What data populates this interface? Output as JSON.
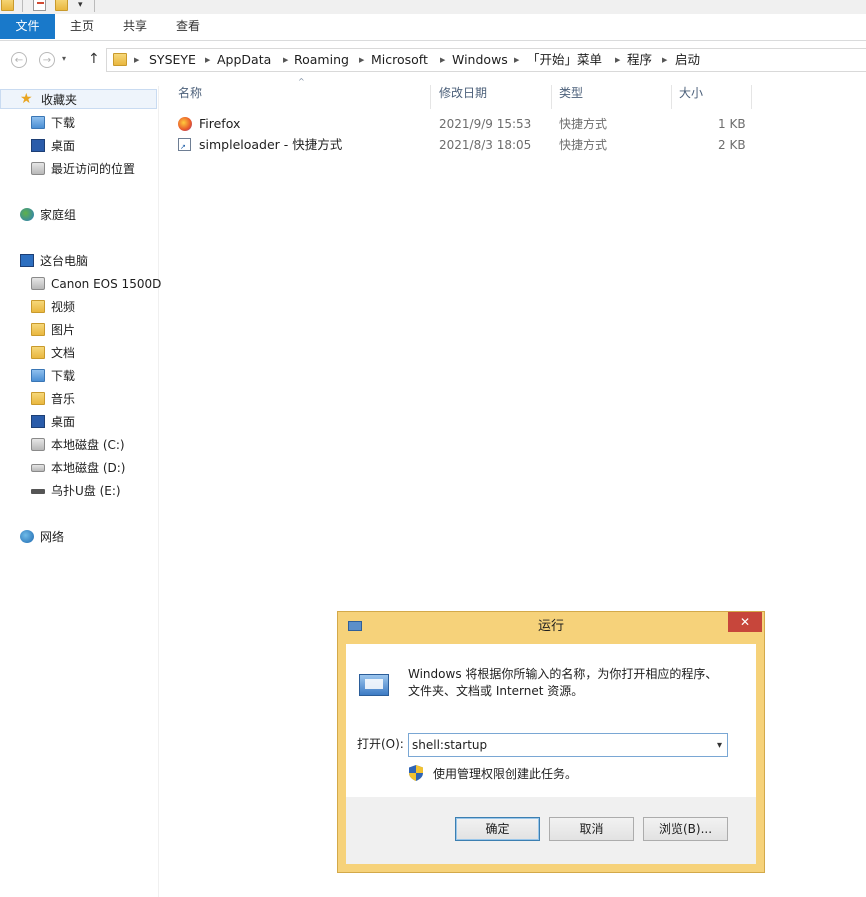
{
  "ribbon": {
    "tabs": [
      "文件",
      "主页",
      "共享",
      "查看"
    ]
  },
  "address": {
    "crumbs": [
      "SYSEYE",
      "AppData",
      "Roaming",
      "Microsoft",
      "Windows",
      "「开始」菜单",
      "程序",
      "启动"
    ]
  },
  "nav": {
    "favorites": "收藏夹",
    "downloads1": "下载",
    "desktop1": "桌面",
    "recent": "最近访问的位置",
    "homegroup": "家庭组",
    "thispc": "这台电脑",
    "camera": "Canon EOS 1500D",
    "videos": "视频",
    "pictures": "图片",
    "documents": "文档",
    "downloads2": "下载",
    "music": "音乐",
    "desktop2": "桌面",
    "drive_c": "本地磁盘 (C:)",
    "drive_d": "本地磁盘 (D:)",
    "drive_e": "乌扑U盘 (E:)",
    "network": "网络"
  },
  "columns": {
    "name": "名称",
    "date": "修改日期",
    "type": "类型",
    "size": "大小"
  },
  "files": [
    {
      "name": "Firefox",
      "date": "2021/9/9 15:53",
      "type": "快捷方式",
      "size": "1 KB"
    },
    {
      "name": "simpleloader - 快捷方式",
      "date": "2021/8/3 18:05",
      "type": "快捷方式",
      "size": "2 KB"
    }
  ],
  "run": {
    "title": "运行",
    "close": "✕",
    "description": "Windows 将根据你所输入的名称，为你打开相应的程序、文件夹、文档或 Internet 资源。",
    "open_label": "打开(O):",
    "open_value": "shell:startup",
    "admin_note": "使用管理权限创建此任务。",
    "ok": "确定",
    "cancel": "取消",
    "browse": "浏览(B)..."
  },
  "colors": {
    "accent": "#1979ca",
    "dialog_frame": "#f6d27a",
    "close_button": "#c7463b"
  }
}
